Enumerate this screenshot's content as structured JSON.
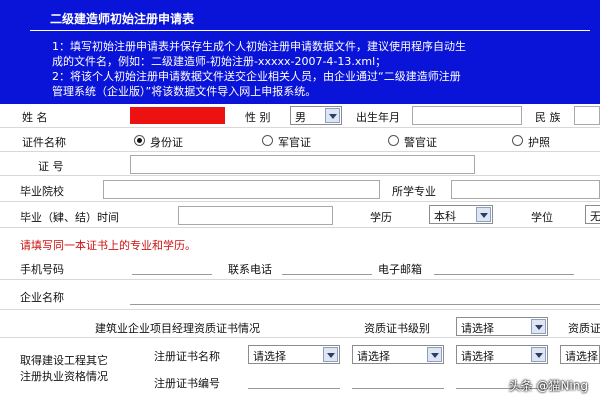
{
  "banner": {
    "title": "二级建造师初始注册申请表",
    "line1": "1：填写初始注册申请表并保存生成个人初始注册申请数据文件，建议使用程序自动生",
    "line2": "成的文件名，例如：二级建造师-初始注册-xxxxx-2007-4-13.xml；",
    "line3": "2：将该个人初始注册申请数据文件送交企业相关人员，由企业通过“二级建造师注册",
    "line4": "管理系统（企业版）”将该数据文件导入网上申报系统。"
  },
  "form": {
    "name_label": "姓  名",
    "gender_label": "性 别",
    "gender_value": "男",
    "birth_label": "出生年月",
    "ethnicity_label": "民 族",
    "cert_type_label": "证件名称",
    "cert_options": [
      "身份证",
      "军官证",
      "警官证",
      "护照"
    ],
    "cert_no_label": "证  号",
    "school_label": "毕业院校",
    "major_label": "所学专业",
    "grad_time_label": "毕业（肄、结）时间",
    "education_label": "学历",
    "education_value": "本科",
    "degree_label": "学位",
    "degree_value": "无",
    "notice": "请填写同一本证书上的专业和学历。",
    "phone_label": "手机号码",
    "tel_label": "联系电话",
    "email_label": "电子邮箱",
    "company_label": "企业名称",
    "pm_cert_label": "建筑业企业项目经理资质证书情况",
    "qual_level_label": "资质证书级别",
    "qual_level_value": "请选择",
    "qual_cert_label": "资质证",
    "obtained_label_1": "取得建设工程其它",
    "obtained_label_2": "注册执业资格情况",
    "reg_cert_name_label": "注册证书名称",
    "reg_cert_no_label": "注册证书编号",
    "select_placeholder": "请选择"
  },
  "watermark": "头条 @猫Ning"
}
